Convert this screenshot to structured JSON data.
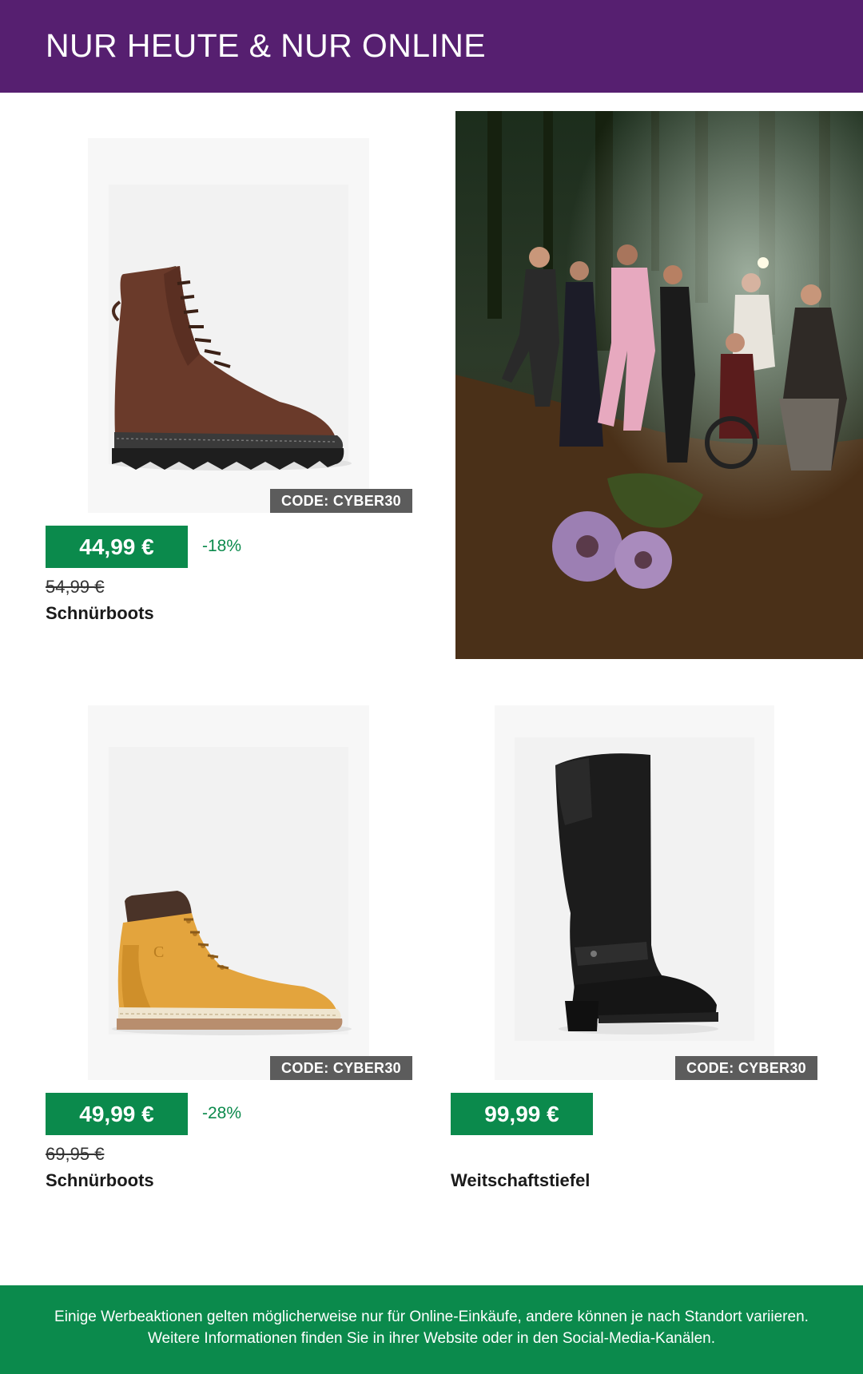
{
  "header": {
    "title": "NUR HEUTE & NUR ONLINE"
  },
  "colors": {
    "brand_purple": "#561f70",
    "price_green": "#0b8a4c",
    "code_badge_gray": "#5c5c5c"
  },
  "products": [
    {
      "name": "Schnürboots",
      "price": "44,99 €",
      "old_price": "54,99 €",
      "discount": "-18%",
      "code": "CODE: CYBER30",
      "image": "brown-lace-up-boot"
    },
    {
      "name": "Schnürboots",
      "price": "49,99 €",
      "old_price": "69,95 €",
      "discount": "-28%",
      "code": "CODE: CYBER30",
      "image": "yellow-lace-up-boot"
    },
    {
      "name": "Weitschaftstiefel",
      "price": "99,99 €",
      "code": "CODE: CYBER30",
      "image": "black-knee-high-boot"
    }
  ],
  "hero_image": "group-photo-in-forest",
  "footer": {
    "disclaimer": "Einige Werbeaktionen gelten möglicherweise nur für Online-Einkäufe, andere können je nach Standort variieren. Weitere Informationen finden Sie in ihrer Website oder in den Social-Media-Kanälen."
  }
}
